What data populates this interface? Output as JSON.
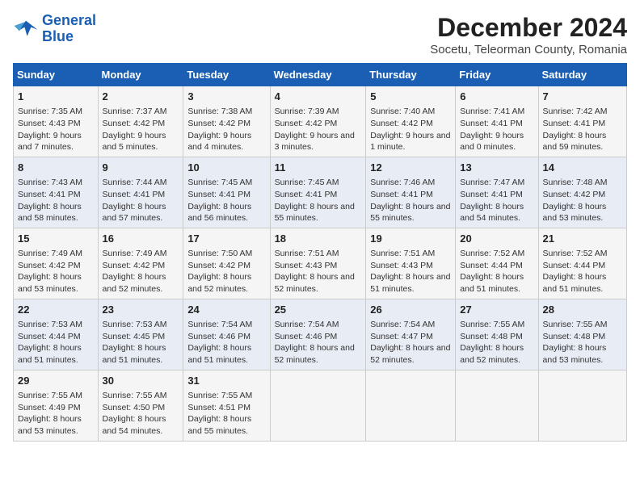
{
  "header": {
    "logo_line1": "General",
    "logo_line2": "Blue",
    "main_title": "December 2024",
    "subtitle": "Socetu, Teleorman County, Romania"
  },
  "columns": [
    "Sunday",
    "Monday",
    "Tuesday",
    "Wednesday",
    "Thursday",
    "Friday",
    "Saturday"
  ],
  "weeks": [
    [
      {
        "day": "1",
        "info": "Sunrise: 7:35 AM\nSunset: 4:43 PM\nDaylight: 9 hours and 7 minutes."
      },
      {
        "day": "2",
        "info": "Sunrise: 7:37 AM\nSunset: 4:42 PM\nDaylight: 9 hours and 5 minutes."
      },
      {
        "day": "3",
        "info": "Sunrise: 7:38 AM\nSunset: 4:42 PM\nDaylight: 9 hours and 4 minutes."
      },
      {
        "day": "4",
        "info": "Sunrise: 7:39 AM\nSunset: 4:42 PM\nDaylight: 9 hours and 3 minutes."
      },
      {
        "day": "5",
        "info": "Sunrise: 7:40 AM\nSunset: 4:42 PM\nDaylight: 9 hours and 1 minute."
      },
      {
        "day": "6",
        "info": "Sunrise: 7:41 AM\nSunset: 4:41 PM\nDaylight: 9 hours and 0 minutes."
      },
      {
        "day": "7",
        "info": "Sunrise: 7:42 AM\nSunset: 4:41 PM\nDaylight: 8 hours and 59 minutes."
      }
    ],
    [
      {
        "day": "8",
        "info": "Sunrise: 7:43 AM\nSunset: 4:41 PM\nDaylight: 8 hours and 58 minutes."
      },
      {
        "day": "9",
        "info": "Sunrise: 7:44 AM\nSunset: 4:41 PM\nDaylight: 8 hours and 57 minutes."
      },
      {
        "day": "10",
        "info": "Sunrise: 7:45 AM\nSunset: 4:41 PM\nDaylight: 8 hours and 56 minutes."
      },
      {
        "day": "11",
        "info": "Sunrise: 7:45 AM\nSunset: 4:41 PM\nDaylight: 8 hours and 55 minutes."
      },
      {
        "day": "12",
        "info": "Sunrise: 7:46 AM\nSunset: 4:41 PM\nDaylight: 8 hours and 55 minutes."
      },
      {
        "day": "13",
        "info": "Sunrise: 7:47 AM\nSunset: 4:41 PM\nDaylight: 8 hours and 54 minutes."
      },
      {
        "day": "14",
        "info": "Sunrise: 7:48 AM\nSunset: 4:42 PM\nDaylight: 8 hours and 53 minutes."
      }
    ],
    [
      {
        "day": "15",
        "info": "Sunrise: 7:49 AM\nSunset: 4:42 PM\nDaylight: 8 hours and 53 minutes."
      },
      {
        "day": "16",
        "info": "Sunrise: 7:49 AM\nSunset: 4:42 PM\nDaylight: 8 hours and 52 minutes."
      },
      {
        "day": "17",
        "info": "Sunrise: 7:50 AM\nSunset: 4:42 PM\nDaylight: 8 hours and 52 minutes."
      },
      {
        "day": "18",
        "info": "Sunrise: 7:51 AM\nSunset: 4:43 PM\nDaylight: 8 hours and 52 minutes."
      },
      {
        "day": "19",
        "info": "Sunrise: 7:51 AM\nSunset: 4:43 PM\nDaylight: 8 hours and 51 minutes."
      },
      {
        "day": "20",
        "info": "Sunrise: 7:52 AM\nSunset: 4:44 PM\nDaylight: 8 hours and 51 minutes."
      },
      {
        "day": "21",
        "info": "Sunrise: 7:52 AM\nSunset: 4:44 PM\nDaylight: 8 hours and 51 minutes."
      }
    ],
    [
      {
        "day": "22",
        "info": "Sunrise: 7:53 AM\nSunset: 4:44 PM\nDaylight: 8 hours and 51 minutes."
      },
      {
        "day": "23",
        "info": "Sunrise: 7:53 AM\nSunset: 4:45 PM\nDaylight: 8 hours and 51 minutes."
      },
      {
        "day": "24",
        "info": "Sunrise: 7:54 AM\nSunset: 4:46 PM\nDaylight: 8 hours and 51 minutes."
      },
      {
        "day": "25",
        "info": "Sunrise: 7:54 AM\nSunset: 4:46 PM\nDaylight: 8 hours and 52 minutes."
      },
      {
        "day": "26",
        "info": "Sunrise: 7:54 AM\nSunset: 4:47 PM\nDaylight: 8 hours and 52 minutes."
      },
      {
        "day": "27",
        "info": "Sunrise: 7:55 AM\nSunset: 4:48 PM\nDaylight: 8 hours and 52 minutes."
      },
      {
        "day": "28",
        "info": "Sunrise: 7:55 AM\nSunset: 4:48 PM\nDaylight: 8 hours and 53 minutes."
      }
    ],
    [
      {
        "day": "29",
        "info": "Sunrise: 7:55 AM\nSunset: 4:49 PM\nDaylight: 8 hours and 53 minutes."
      },
      {
        "day": "30",
        "info": "Sunrise: 7:55 AM\nSunset: 4:50 PM\nDaylight: 8 hours and 54 minutes."
      },
      {
        "day": "31",
        "info": "Sunrise: 7:55 AM\nSunset: 4:51 PM\nDaylight: 8 hours and 55 minutes."
      },
      null,
      null,
      null,
      null
    ]
  ]
}
